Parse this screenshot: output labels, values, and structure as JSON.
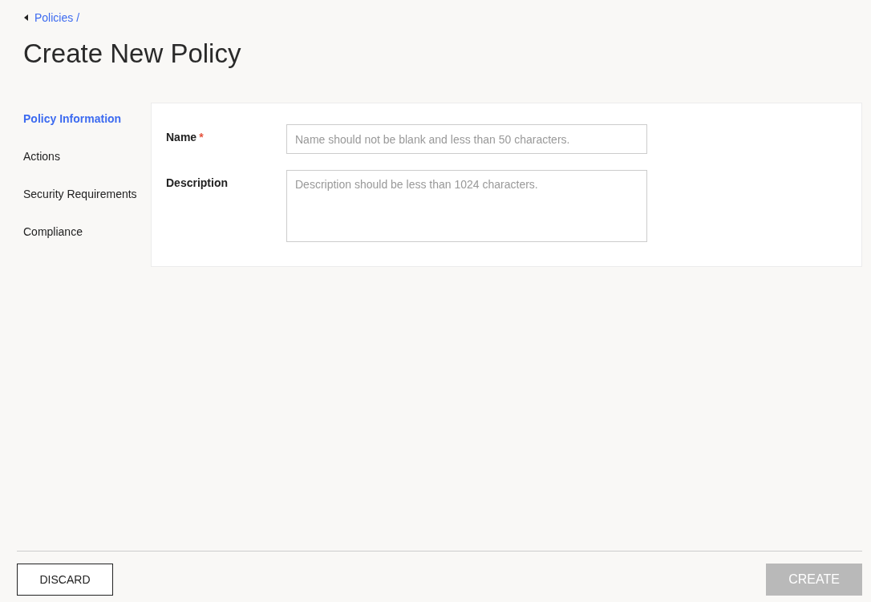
{
  "breadcrumb": {
    "label": "Policies /"
  },
  "title": "Create New Policy",
  "sidebar": {
    "items": [
      {
        "label": "Policy Information",
        "selected": true
      },
      {
        "label": "Actions",
        "selected": false
      },
      {
        "label": "Security Requirements",
        "selected": false
      },
      {
        "label": "Compliance",
        "selected": false
      }
    ]
  },
  "form": {
    "fields": [
      {
        "kind": "text",
        "label": "Name",
        "required_mark": "*",
        "placeholder": "Name should not be blank and less than 50 characters."
      },
      {
        "kind": "textarea",
        "label": "Description",
        "placeholder": "Description should be less than 1024 characters."
      }
    ]
  },
  "footer": {
    "discard": {
      "label": "DISCARD"
    },
    "create": {
      "label": "CREATE",
      "disabled": true
    }
  }
}
